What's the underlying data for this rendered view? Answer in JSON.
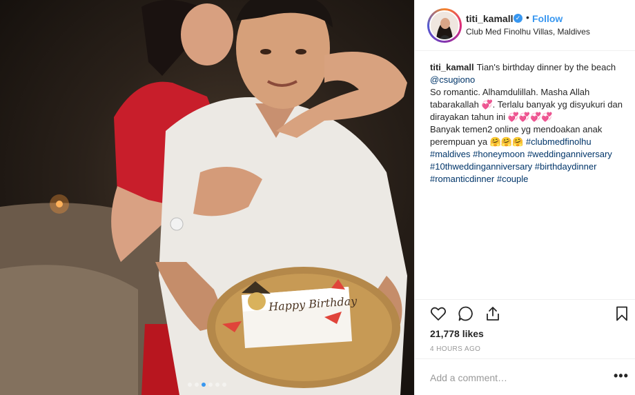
{
  "post": {
    "username": "titi_kamall",
    "follow_label": "Follow",
    "separator": "•",
    "verified_glyph": "✓",
    "location": "Club Med Finolhu Villas, Maldives",
    "caption": {
      "user": "titi_kamall",
      "line1_text": "Tian's birthday dinner by the beach ",
      "line1_mention": "@csugiono",
      "line2": "So romantic. Alhamdulillah. Masha Allah tabarakallah 💞. Terlalu banyak yg disyukuri dan dirayakan tahun ini 💞💞💞💞",
      "line3_text": "Banyak temen2 online yg mendoakan anak perempuan ya 🤗🤗🤗 ",
      "hashtags": [
        "#clubmedfinolhu",
        "#maldives",
        "#honeymoon",
        "#weddinganniversary",
        "#10thweddinganniversary",
        "#birthdaydinner",
        "#romanticdinner",
        "#couple"
      ]
    },
    "likes": "21,778 likes",
    "time_ago": "4 HOURS AGO",
    "comment_placeholder": "Add a comment…",
    "more_glyph": "•••",
    "cake_text": "Happy Birthday",
    "carousel": {
      "count": 6,
      "active_index": 2
    }
  },
  "colors": {
    "link": "#3897f0",
    "hashtag": "#003569",
    "text": "#262626",
    "muted": "#999999",
    "border": "#efefef"
  },
  "icons": {
    "like": "heart-icon",
    "comment": "comment-icon",
    "share": "share-icon",
    "save": "bookmark-icon",
    "verified": "verified-badge-icon"
  }
}
